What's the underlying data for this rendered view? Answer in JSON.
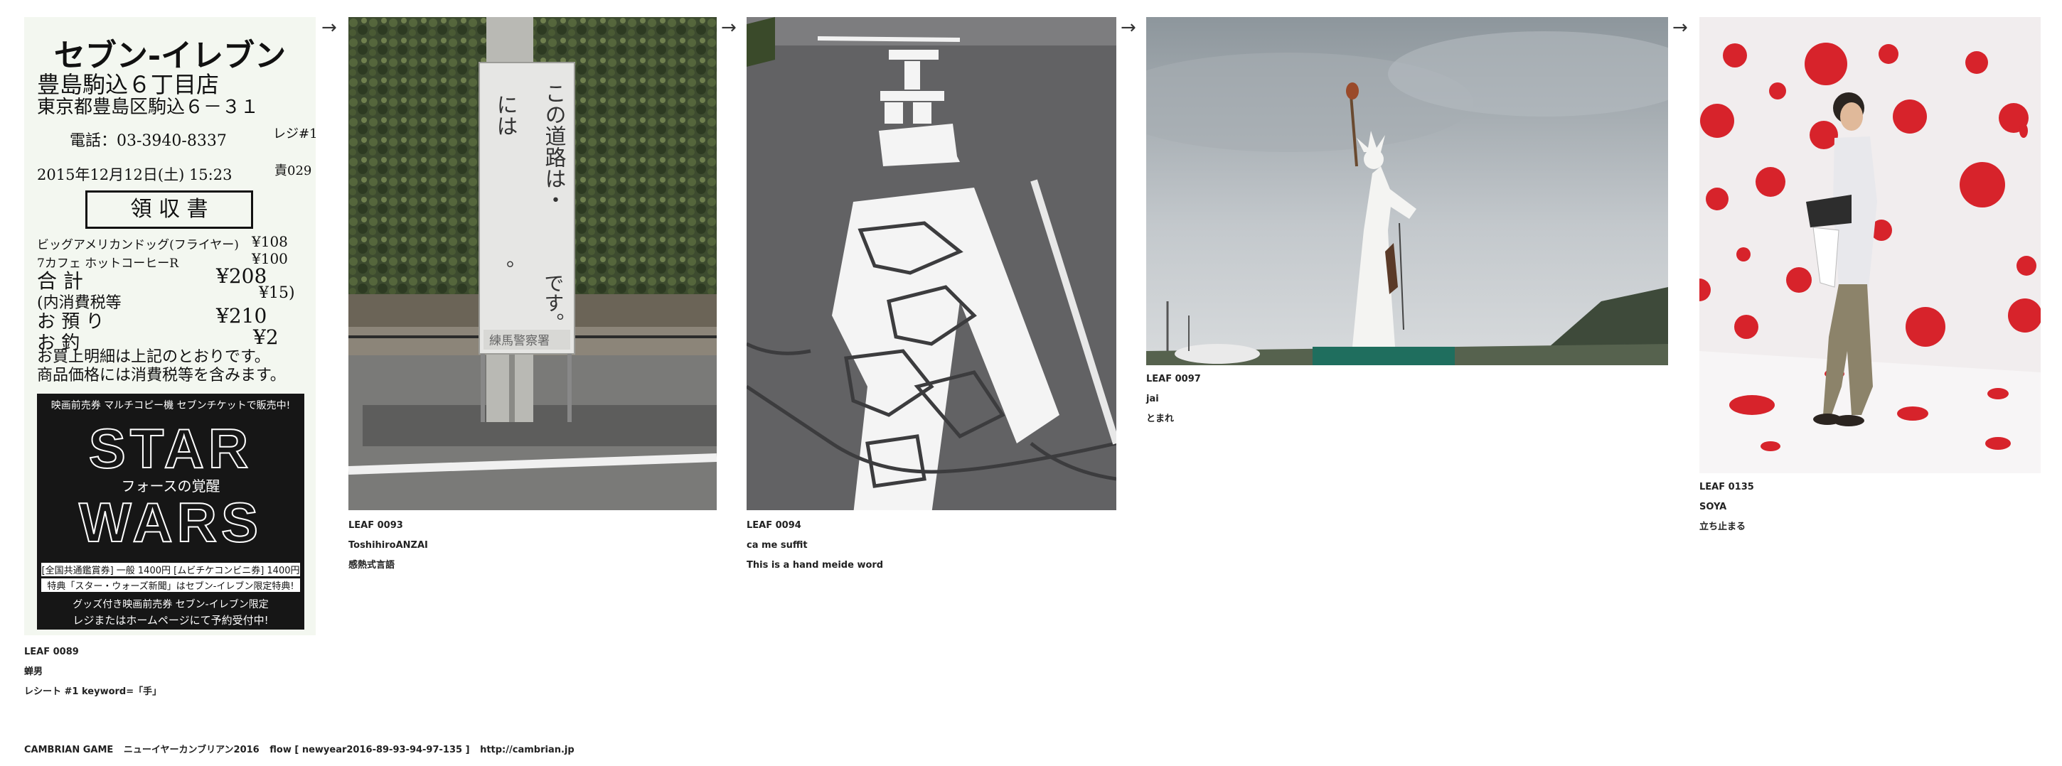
{
  "leaves": [
    {
      "id": "LEAF 0089",
      "author": "蝉男",
      "caption": "レシート #1 keyword=「手」",
      "receipt": {
        "store_logo": "セブン-イレブン",
        "store_name": "豊島駒込６丁目店",
        "address": "東京都豊島区駒込６－３１",
        "phone": "電話：03-3940-8337",
        "register": "レジ#1",
        "datetime": "2015年12月12日(土) 15:23",
        "clerk": "責029",
        "title": "領 収 書",
        "items": [
          {
            "name": "ビッグアメリカンドッグ(フライヤー)",
            "price": "¥108"
          },
          {
            "name": "7カフェ ホットコーヒーR",
            "price": "¥100"
          }
        ],
        "total_label": "合 計",
        "total": "¥208",
        "tax_label": "(内消費税等",
        "tax": "¥15)",
        "paid_label": "お 預 り",
        "paid": "¥210",
        "change_label": "お 釣",
        "change": "¥2",
        "note1": "お買上明細は上記のとおりです。",
        "note2": "商品価格には消費税等を含みます。",
        "ad_top": "映画前売券 マルチコピー機 セブンチケットで販売中!",
        "ad_star": "STAR",
        "ad_sub": "フォースの覚醒",
        "ad_wars": "WARS",
        "ad_price": "[全国共通鑑賞券] 一般 1400円 [ムビチケコンビニ券] 1400円",
        "ad_bonus": "特典「スター・ウォーズ新聞」はセブン-イレブン限定特典!",
        "ad_goods": "グッズ付き映画前売券 セブン-イレブン限定",
        "ad_reserve": "レジまたはホームページにて予約受付中!"
      }
    },
    {
      "id": "LEAF 0093",
      "author": "ToshihiroANZAI",
      "caption": "感熱式言語",
      "sign": {
        "col1": "この道路は・",
        "col2": "には",
        "col3": "です。",
        "dot": "。",
        "footer": "練馬警察署"
      }
    },
    {
      "id": "LEAF 0094",
      "author": "ca me suffit",
      "caption": "This is a hand meide word"
    },
    {
      "id": "LEAF 0097",
      "author": "jai",
      "caption": "とまれ"
    },
    {
      "id": "LEAF 0135",
      "author": "SOYA",
      "caption": "立ち止まる"
    }
  ],
  "arrow_glyph": "→",
  "footer": {
    "game": "CAMBRIAN GAME",
    "event": "ニューイヤーカンブリアン2016",
    "flow": "flow [ newyear2016-89-93-94-97-135 ]",
    "url": "http://cambrian.jp"
  }
}
